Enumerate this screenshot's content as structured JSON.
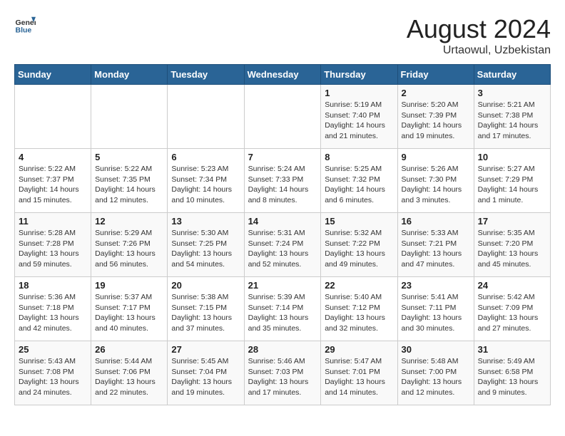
{
  "header": {
    "logo_general": "General",
    "logo_blue": "Blue",
    "title": "August 2024",
    "subtitle": "Urtaowul, Uzbekistan"
  },
  "calendar": {
    "days_of_week": [
      "Sunday",
      "Monday",
      "Tuesday",
      "Wednesday",
      "Thursday",
      "Friday",
      "Saturday"
    ],
    "weeks": [
      [
        {
          "day": "",
          "info": ""
        },
        {
          "day": "",
          "info": ""
        },
        {
          "day": "",
          "info": ""
        },
        {
          "day": "",
          "info": ""
        },
        {
          "day": "1",
          "info": "Sunrise: 5:19 AM\nSunset: 7:40 PM\nDaylight: 14 hours\nand 21 minutes."
        },
        {
          "day": "2",
          "info": "Sunrise: 5:20 AM\nSunset: 7:39 PM\nDaylight: 14 hours\nand 19 minutes."
        },
        {
          "day": "3",
          "info": "Sunrise: 5:21 AM\nSunset: 7:38 PM\nDaylight: 14 hours\nand 17 minutes."
        }
      ],
      [
        {
          "day": "4",
          "info": "Sunrise: 5:22 AM\nSunset: 7:37 PM\nDaylight: 14 hours\nand 15 minutes."
        },
        {
          "day": "5",
          "info": "Sunrise: 5:22 AM\nSunset: 7:35 PM\nDaylight: 14 hours\nand 12 minutes."
        },
        {
          "day": "6",
          "info": "Sunrise: 5:23 AM\nSunset: 7:34 PM\nDaylight: 14 hours\nand 10 minutes."
        },
        {
          "day": "7",
          "info": "Sunrise: 5:24 AM\nSunset: 7:33 PM\nDaylight: 14 hours\nand 8 minutes."
        },
        {
          "day": "8",
          "info": "Sunrise: 5:25 AM\nSunset: 7:32 PM\nDaylight: 14 hours\nand 6 minutes."
        },
        {
          "day": "9",
          "info": "Sunrise: 5:26 AM\nSunset: 7:30 PM\nDaylight: 14 hours\nand 3 minutes."
        },
        {
          "day": "10",
          "info": "Sunrise: 5:27 AM\nSunset: 7:29 PM\nDaylight: 14 hours\nand 1 minute."
        }
      ],
      [
        {
          "day": "11",
          "info": "Sunrise: 5:28 AM\nSunset: 7:28 PM\nDaylight: 13 hours\nand 59 minutes."
        },
        {
          "day": "12",
          "info": "Sunrise: 5:29 AM\nSunset: 7:26 PM\nDaylight: 13 hours\nand 56 minutes."
        },
        {
          "day": "13",
          "info": "Sunrise: 5:30 AM\nSunset: 7:25 PM\nDaylight: 13 hours\nand 54 minutes."
        },
        {
          "day": "14",
          "info": "Sunrise: 5:31 AM\nSunset: 7:24 PM\nDaylight: 13 hours\nand 52 minutes."
        },
        {
          "day": "15",
          "info": "Sunrise: 5:32 AM\nSunset: 7:22 PM\nDaylight: 13 hours\nand 49 minutes."
        },
        {
          "day": "16",
          "info": "Sunrise: 5:33 AM\nSunset: 7:21 PM\nDaylight: 13 hours\nand 47 minutes."
        },
        {
          "day": "17",
          "info": "Sunrise: 5:35 AM\nSunset: 7:20 PM\nDaylight: 13 hours\nand 45 minutes."
        }
      ],
      [
        {
          "day": "18",
          "info": "Sunrise: 5:36 AM\nSunset: 7:18 PM\nDaylight: 13 hours\nand 42 minutes."
        },
        {
          "day": "19",
          "info": "Sunrise: 5:37 AM\nSunset: 7:17 PM\nDaylight: 13 hours\nand 40 minutes."
        },
        {
          "day": "20",
          "info": "Sunrise: 5:38 AM\nSunset: 7:15 PM\nDaylight: 13 hours\nand 37 minutes."
        },
        {
          "day": "21",
          "info": "Sunrise: 5:39 AM\nSunset: 7:14 PM\nDaylight: 13 hours\nand 35 minutes."
        },
        {
          "day": "22",
          "info": "Sunrise: 5:40 AM\nSunset: 7:12 PM\nDaylight: 13 hours\nand 32 minutes."
        },
        {
          "day": "23",
          "info": "Sunrise: 5:41 AM\nSunset: 7:11 PM\nDaylight: 13 hours\nand 30 minutes."
        },
        {
          "day": "24",
          "info": "Sunrise: 5:42 AM\nSunset: 7:09 PM\nDaylight: 13 hours\nand 27 minutes."
        }
      ],
      [
        {
          "day": "25",
          "info": "Sunrise: 5:43 AM\nSunset: 7:08 PM\nDaylight: 13 hours\nand 24 minutes."
        },
        {
          "day": "26",
          "info": "Sunrise: 5:44 AM\nSunset: 7:06 PM\nDaylight: 13 hours\nand 22 minutes."
        },
        {
          "day": "27",
          "info": "Sunrise: 5:45 AM\nSunset: 7:04 PM\nDaylight: 13 hours\nand 19 minutes."
        },
        {
          "day": "28",
          "info": "Sunrise: 5:46 AM\nSunset: 7:03 PM\nDaylight: 13 hours\nand 17 minutes."
        },
        {
          "day": "29",
          "info": "Sunrise: 5:47 AM\nSunset: 7:01 PM\nDaylight: 13 hours\nand 14 minutes."
        },
        {
          "day": "30",
          "info": "Sunrise: 5:48 AM\nSunset: 7:00 PM\nDaylight: 13 hours\nand 12 minutes."
        },
        {
          "day": "31",
          "info": "Sunrise: 5:49 AM\nSunset: 6:58 PM\nDaylight: 13 hours\nand 9 minutes."
        }
      ]
    ]
  }
}
